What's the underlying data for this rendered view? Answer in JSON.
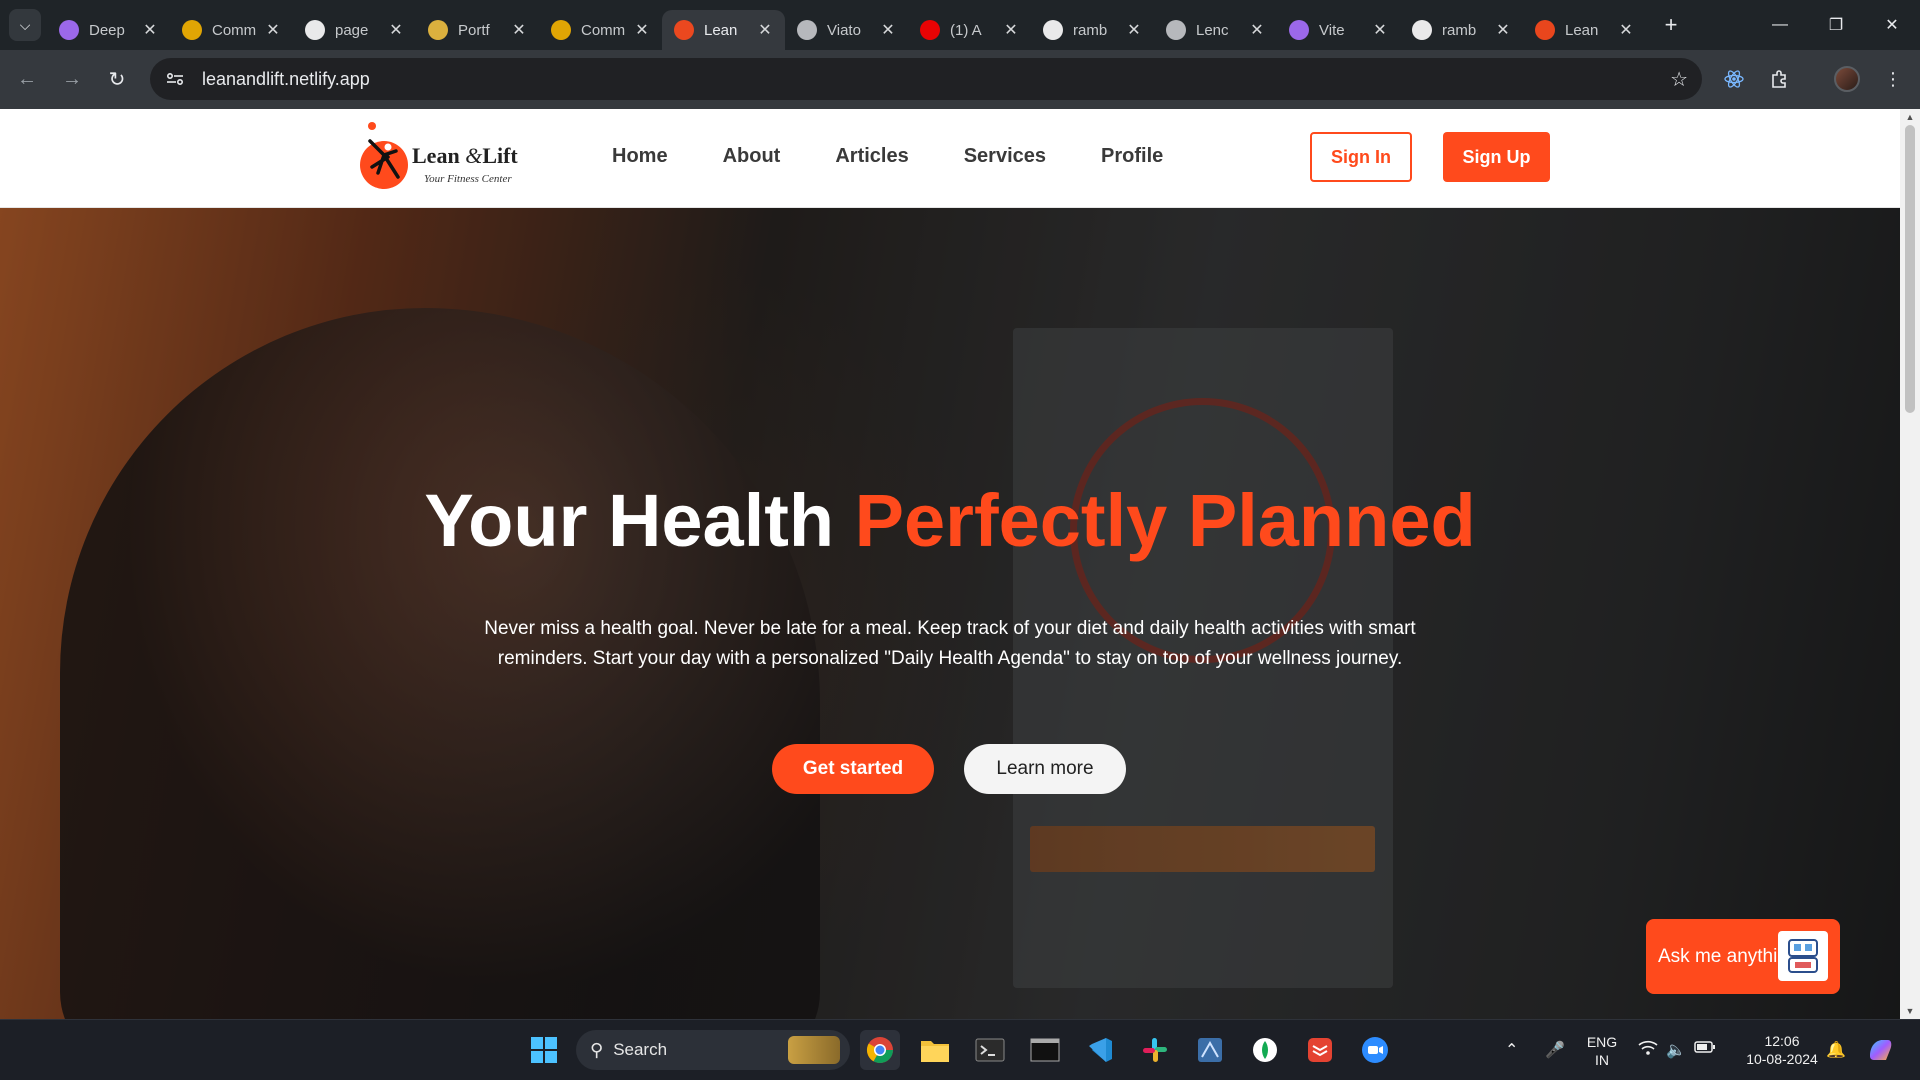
{
  "browser": {
    "tabs": [
      {
        "title": "Deep",
        "favicon": "vite-logo-icon",
        "color": "#a970ff"
      },
      {
        "title": "Comm",
        "favicon": "hands-icon",
        "color": "#f5b400"
      },
      {
        "title": "page",
        "favicon": "github-icon",
        "color": "#ffffff"
      },
      {
        "title": "Portf",
        "favicon": "avatar-icon",
        "color": "#f0c040"
      },
      {
        "title": "Comm",
        "favicon": "hands-icon",
        "color": "#f5b400"
      },
      {
        "title": "Lean",
        "favicon": "lean-lift-icon",
        "color": "#ff4a1c"
      },
      {
        "title": "Viato",
        "favicon": "globe-icon",
        "color": "#c6c9cc"
      },
      {
        "title": "(1) A",
        "favicon": "youtube-icon",
        "color": "#ff0000"
      },
      {
        "title": "ramb",
        "favicon": "github-icon",
        "color": "#ffffff"
      },
      {
        "title": "Lenc",
        "favicon": "globe-icon",
        "color": "#c6c9cc"
      },
      {
        "title": "Vite",
        "favicon": "vite-logo-icon",
        "color": "#a970ff"
      },
      {
        "title": "ramb",
        "favicon": "github-icon",
        "color": "#ffffff"
      },
      {
        "title": "Lean",
        "favicon": "lean-lift-icon",
        "color": "#ff4a1c"
      }
    ],
    "active_tab_index": 5,
    "url": "leanandlift.netlify.app"
  },
  "site": {
    "logo": {
      "name_part1": "Lean ",
      "name_amp": "&",
      "name_part2": "Lift",
      "tagline": "Your Fitness Center"
    },
    "nav": [
      "Home",
      "About",
      "Articles",
      "Services",
      "Profile"
    ],
    "sign_in": "Sign In",
    "sign_up": "Sign Up",
    "hero": {
      "title_white": "Your Health ",
      "title_accent": "Perfectly Planned",
      "description": "Never miss a health goal. Never be late for a meal. Keep track of your diet and daily health activities with smart reminders. Start your day with a personalized \"Daily Health Agenda\" to stay on top of your wellness journey.",
      "cta_primary": "Get started",
      "cta_secondary": "Learn more"
    },
    "chat_widget": "Ask me anything",
    "accent_color": "#ff4a1c"
  },
  "taskbar": {
    "search_placeholder": "Search",
    "language": "ENG",
    "region": "IN",
    "time": "12:06",
    "date": "10-08-2024"
  }
}
